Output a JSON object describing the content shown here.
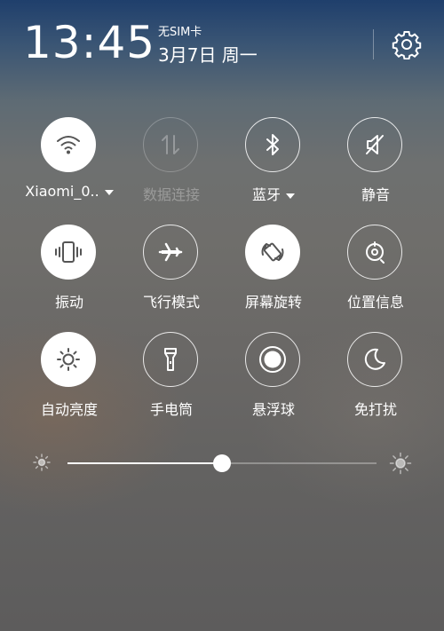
{
  "status": {
    "time": "13:45",
    "sim": "无SIM卡",
    "date": "3月7日 周一"
  },
  "icons": {
    "settings": "gear-icon"
  },
  "toggles": [
    {
      "id": "wifi",
      "label": "Xiaomi_0..",
      "on": true,
      "dropdown": true,
      "icon": "wifi-icon"
    },
    {
      "id": "data",
      "label": "数据连接",
      "on": false,
      "disabled": true,
      "icon": "data-arrows-icon"
    },
    {
      "id": "bluetooth",
      "label": "蓝牙",
      "on": false,
      "dropdown": true,
      "icon": "bluetooth-icon"
    },
    {
      "id": "mute",
      "label": "静音",
      "on": false,
      "icon": "mute-icon"
    },
    {
      "id": "vibrate",
      "label": "振动",
      "on": true,
      "icon": "vibrate-icon"
    },
    {
      "id": "airplane",
      "label": "飞行模式",
      "on": false,
      "icon": "airplane-icon"
    },
    {
      "id": "rotate",
      "label": "屏幕旋转",
      "on": true,
      "icon": "rotate-icon"
    },
    {
      "id": "location",
      "label": "位置信息",
      "on": false,
      "icon": "location-icon"
    },
    {
      "id": "autobright",
      "label": "自动亮度",
      "on": true,
      "icon": "auto-brightness-icon"
    },
    {
      "id": "flashlight",
      "label": "手电筒",
      "on": false,
      "icon": "flashlight-icon"
    },
    {
      "id": "floatball",
      "label": "悬浮球",
      "on": false,
      "icon": "floating-ball-icon"
    },
    {
      "id": "dnd",
      "label": "免打扰",
      "on": false,
      "icon": "moon-icon"
    }
  ],
  "brightness": {
    "level": 0.5
  },
  "colors": {
    "on_tile": "#ffffff",
    "icon_on": "#555555",
    "icon_off": "#ffffff"
  }
}
